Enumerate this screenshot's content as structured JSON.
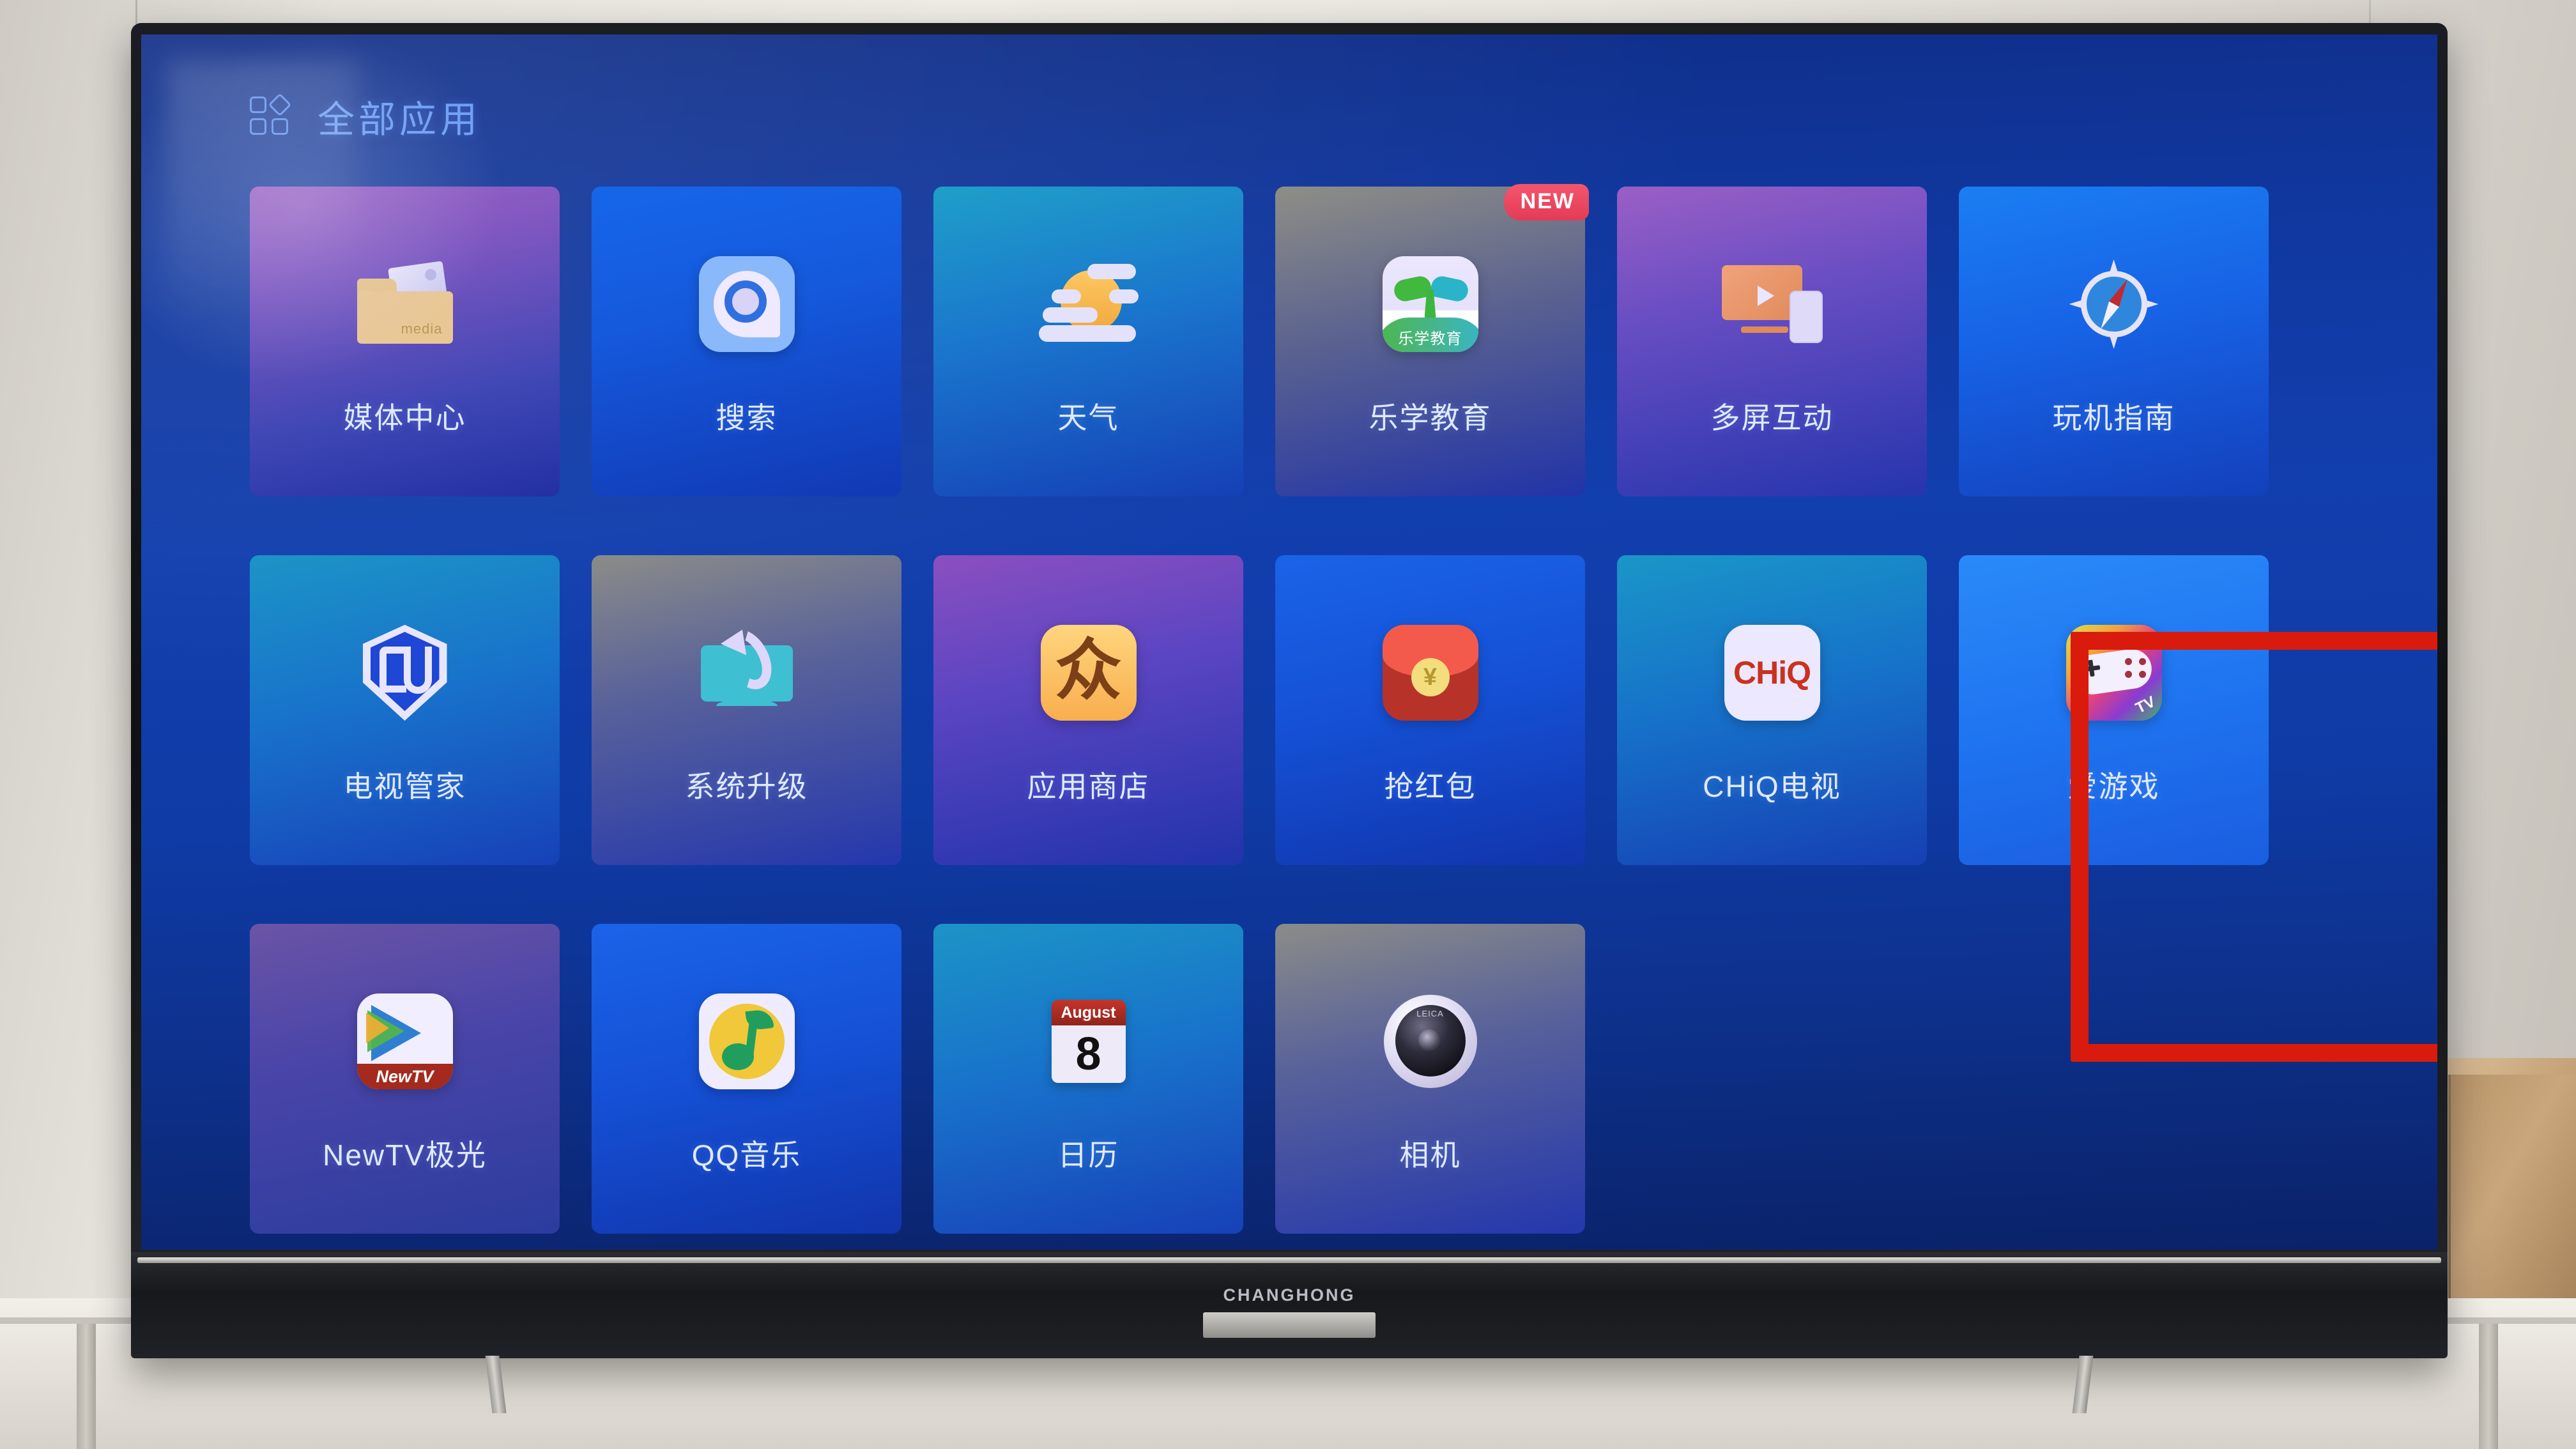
{
  "device": {
    "brand": "CHANGHONG",
    "bezel_color": "#16181c"
  },
  "header": {
    "title": "全部应用",
    "icon": "grid-apps-icon",
    "title_color": "#6fa0f5"
  },
  "annotation": {
    "color": "#d81b0c",
    "targets": "爱游戏"
  },
  "apps": [
    {
      "label": "媒体中心",
      "icon": "media-folder-icon",
      "tile_bg": "bg-media",
      "badge": null
    },
    {
      "label": "搜索",
      "icon": "search-icon",
      "tile_bg": "bg-blue",
      "badge": null
    },
    {
      "label": "天气",
      "icon": "weather-sun-cloud-icon",
      "tile_bg": "bg-teal",
      "badge": null
    },
    {
      "label": "乐学教育",
      "icon": "sprout-education-icon",
      "tile_bg": "bg-grey",
      "badge": "NEW",
      "icon_text": "乐学教育"
    },
    {
      "label": "多屏互动",
      "icon": "screen-cast-icon",
      "tile_bg": "bg-purple",
      "badge": null
    },
    {
      "label": "玩机指南",
      "icon": "compass-icon",
      "tile_bg": "bg-brightblue",
      "badge": null
    },
    {
      "label": "电视管家",
      "icon": "shield-icon",
      "tile_bg": "bg-teal2",
      "badge": null
    },
    {
      "label": "系统升级",
      "icon": "tv-upgrade-arrow-icon",
      "tile_bg": "bg-greyblue",
      "badge": null
    },
    {
      "label": "应用商店",
      "icon": "app-store-icon",
      "tile_bg": "bg-violet",
      "badge": null,
      "icon_text": "众"
    },
    {
      "label": "抢红包",
      "icon": "red-packet-icon",
      "tile_bg": "bg-royal",
      "badge": null,
      "icon_text": "¥"
    },
    {
      "label": "CHiQ电视",
      "icon": "chiq-logo-icon",
      "tile_bg": "bg-cyanblue",
      "badge": null,
      "icon_text": "CHiQ"
    },
    {
      "label": "爱游戏",
      "icon": "gamepad-icon",
      "tile_bg": "bg-focus",
      "badge": null,
      "icon_text": "TV",
      "focused": true
    },
    {
      "label": "NewTV极光",
      "icon": "newtv-play-icon",
      "tile_bg": "bg-mutedpur",
      "badge": null,
      "icon_text": "NewTV"
    },
    {
      "label": "QQ音乐",
      "icon": "music-note-icon",
      "tile_bg": "bg-royal",
      "badge": null
    },
    {
      "label": "日历",
      "icon": "calendar-icon",
      "tile_bg": "bg-teal2",
      "badge": null,
      "icon_month": "August",
      "icon_day": "8"
    },
    {
      "label": "相机",
      "icon": "camera-lens-icon",
      "tile_bg": "bg-greyblue",
      "badge": null,
      "icon_text": "LEICA"
    }
  ]
}
